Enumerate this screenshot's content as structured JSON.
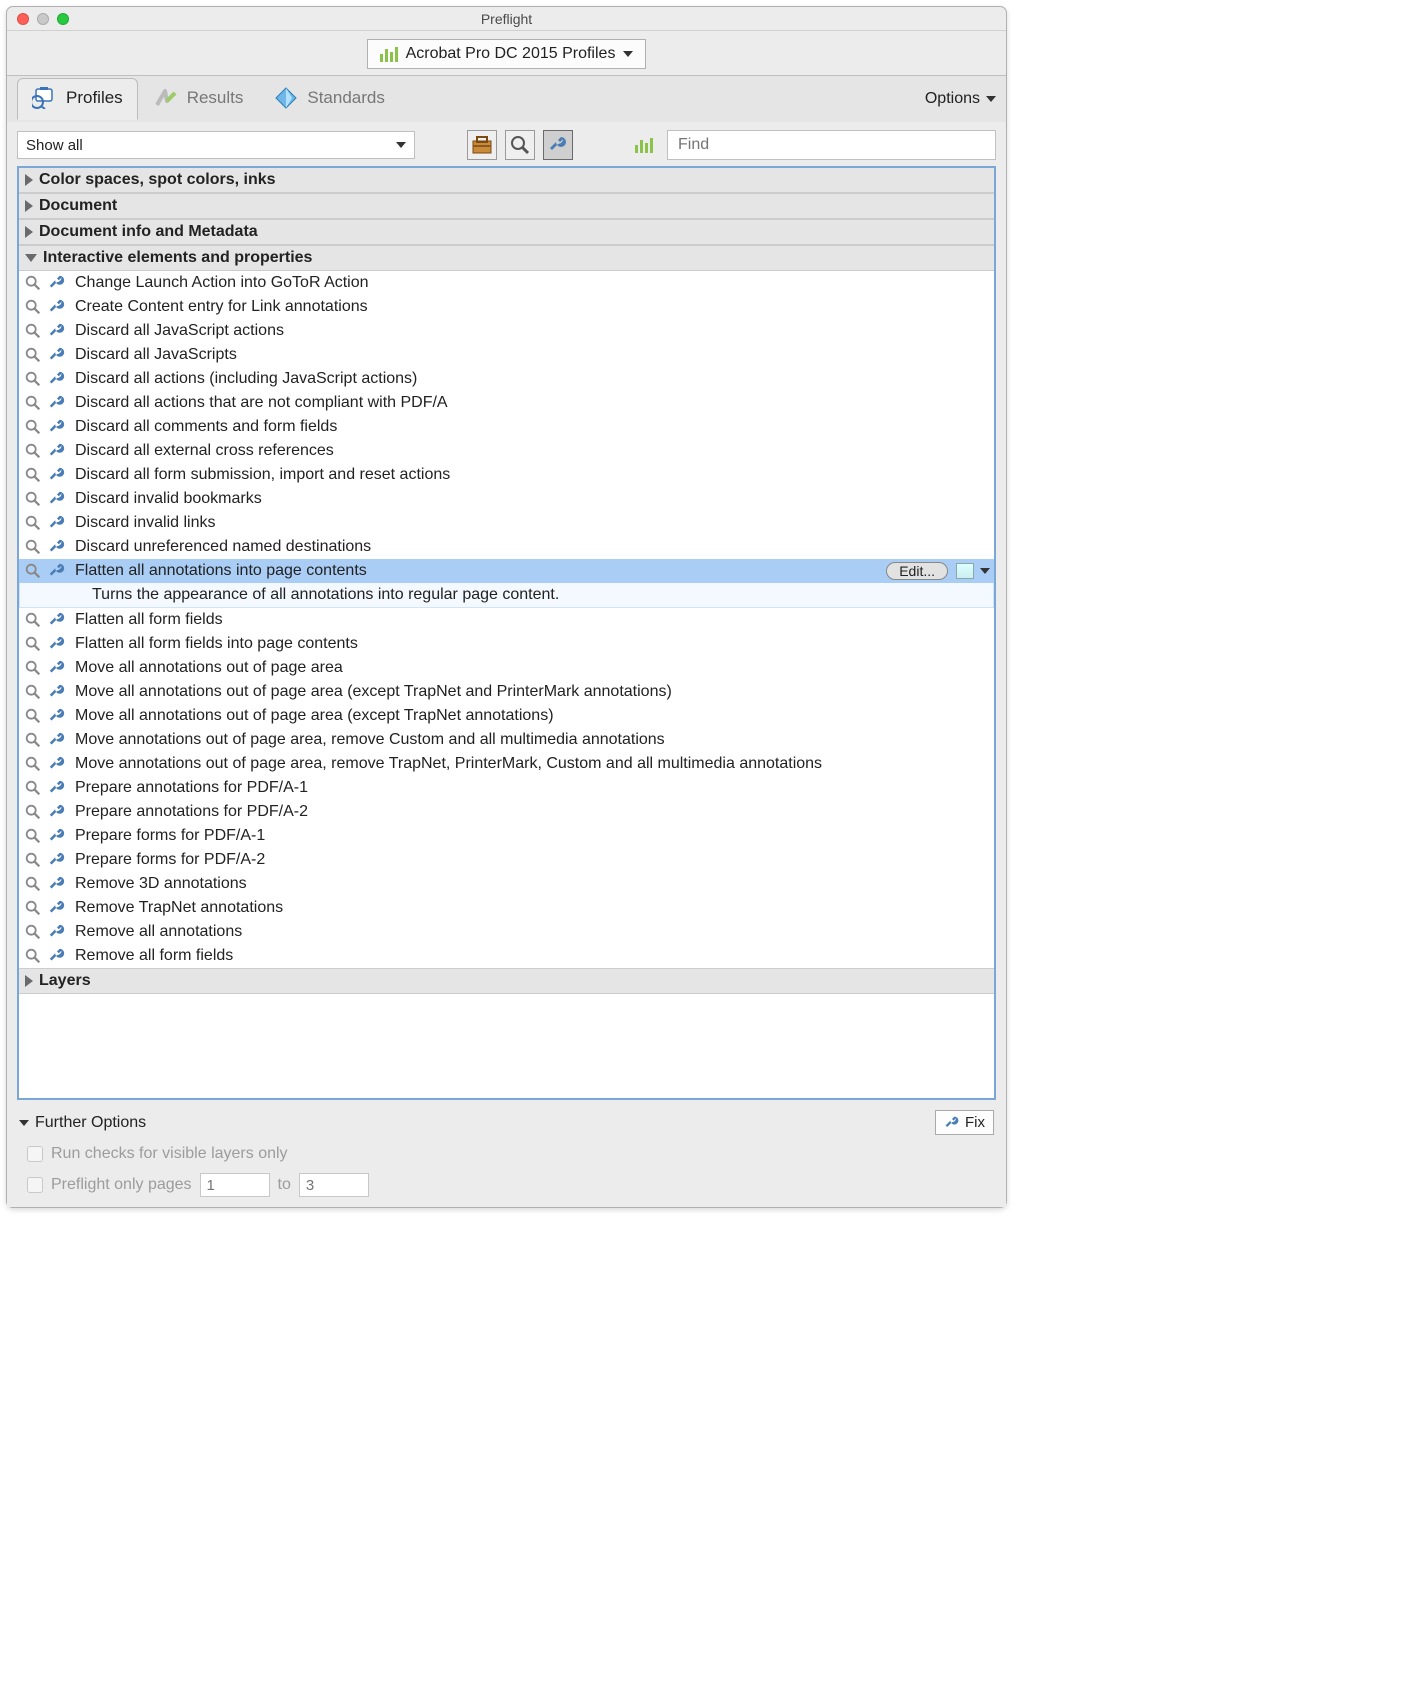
{
  "window": {
    "title": "Preflight"
  },
  "profile_selector": {
    "label": "Acrobat Pro DC 2015 Profiles"
  },
  "tabs": {
    "profiles": "Profiles",
    "results": "Results",
    "standards": "Standards"
  },
  "options_label": "Options",
  "showall_label": "Show all",
  "find_placeholder": "Find",
  "categories": [
    {
      "label": "Color spaces, spot colors, inks",
      "expanded": false
    },
    {
      "label": "Document",
      "expanded": false
    },
    {
      "label": "Document info and Metadata",
      "expanded": false
    },
    {
      "label": "Interactive elements and properties",
      "expanded": true
    },
    {
      "label": "Layers",
      "expanded": false
    }
  ],
  "items": [
    "Change Launch Action into GoToR Action",
    "Create Content entry for Link annotations",
    "Discard all JavaScript actions",
    "Discard all JavaScripts",
    "Discard all actions (including JavaScript actions)",
    "Discard all actions that are not compliant with PDF/A",
    "Discard all comments and form fields",
    "Discard all external cross references",
    "Discard all form submission, import and reset actions",
    "Discard invalid bookmarks",
    "Discard invalid links",
    "Discard unreferenced named destinations",
    "Flatten all annotations into page contents",
    "Flatten all form fields",
    "Flatten all form fields into page contents",
    "Move all annotations out of page area",
    "Move all annotations out of page area (except TrapNet and PrinterMark annotations)",
    "Move all annotations out of page area (except TrapNet annotations)",
    "Move annotations out of page area, remove Custom and all multimedia annotations",
    "Move annotations out of page area, remove TrapNet, PrinterMark, Custom and all multimedia annotations",
    "Prepare annotations for PDF/A-1",
    "Prepare annotations for PDF/A-2",
    "Prepare forms for PDF/A-1",
    "Prepare forms for PDF/A-2",
    "Remove 3D annotations",
    "Remove TrapNet annotations",
    "Remove all annotations",
    "Remove all form fields"
  ],
  "selected_index": 12,
  "selected_description": "Turns the appearance of all annotations into regular page content.",
  "edit_label": "Edit...",
  "further": {
    "title": "Further Options",
    "fix": "Fix",
    "checks_label": "Run checks for visible layers only",
    "pages_label": "Preflight only pages",
    "page_from": "1",
    "to_label": "to",
    "page_to": "3"
  }
}
